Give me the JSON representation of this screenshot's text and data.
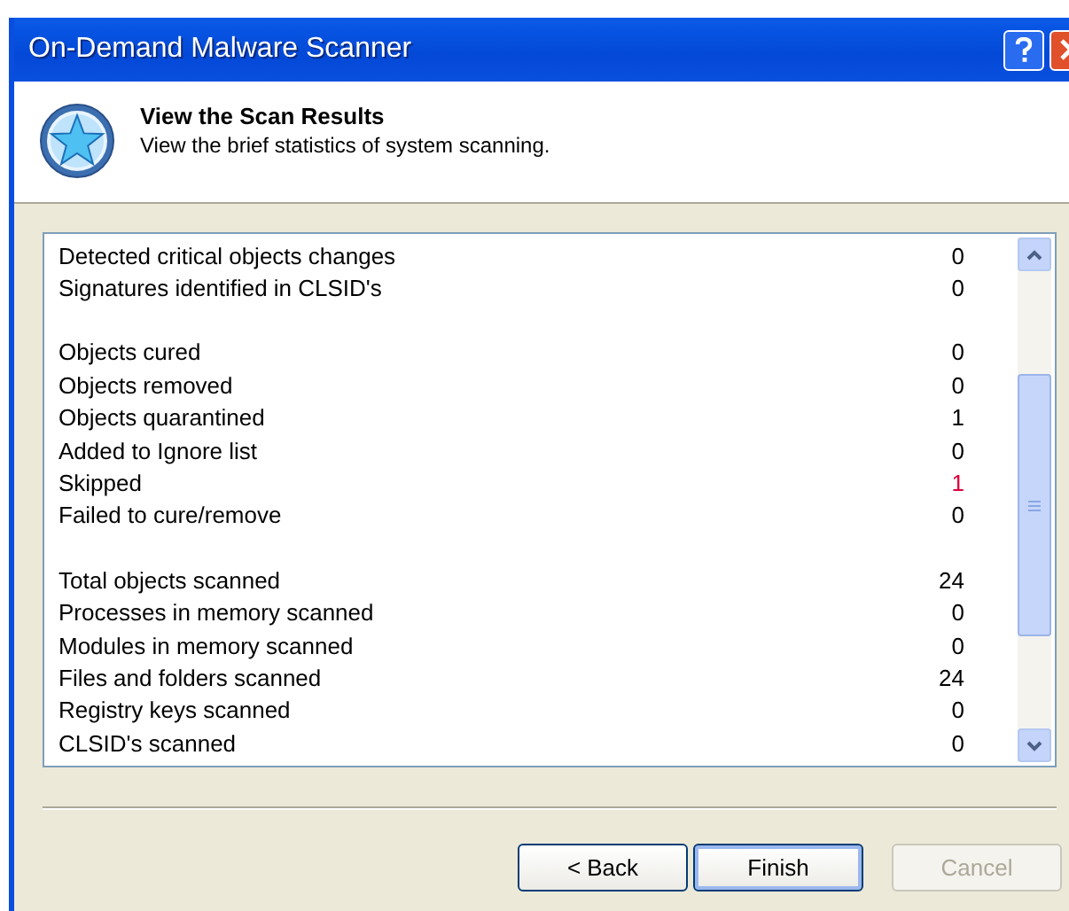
{
  "window": {
    "title": "On-Demand Malware Scanner"
  },
  "header": {
    "title": "View the Scan Results",
    "subtitle": "View the brief statistics of system scanning."
  },
  "results": {
    "groups": [
      {
        "rows": [
          {
            "label": "Detected critical objects changes",
            "value": "0",
            "color": "#000000"
          },
          {
            "label": "Signatures identified in CLSID's",
            "value": "0",
            "color": "#000000"
          }
        ]
      },
      {
        "rows": [
          {
            "label": "Objects cured",
            "value": "0",
            "color": "#000000"
          },
          {
            "label": "Objects removed",
            "value": "0",
            "color": "#000000"
          },
          {
            "label": "Objects quarantined",
            "value": "1",
            "color": "#000000"
          },
          {
            "label": "Added to Ignore list",
            "value": "0",
            "color": "#000000"
          },
          {
            "label": "Skipped",
            "value": "1",
            "color": "#e0003c"
          },
          {
            "label": "Failed to cure/remove",
            "value": "0",
            "color": "#000000"
          }
        ]
      },
      {
        "rows": [
          {
            "label": "Total objects scanned",
            "value": "24",
            "color": "#000000"
          },
          {
            "label": "Processes in memory scanned",
            "value": "0",
            "color": "#000000"
          },
          {
            "label": "Modules in memory scanned",
            "value": "0",
            "color": "#000000"
          },
          {
            "label": "Files and folders scanned",
            "value": "24",
            "color": "#000000"
          },
          {
            "label": "Registry keys scanned",
            "value": "0",
            "color": "#000000"
          },
          {
            "label": "CLSID's scanned",
            "value": "0",
            "color": "#000000"
          }
        ]
      }
    ]
  },
  "buttons": [
    {
      "label": "< Back",
      "disabled": false,
      "default": false
    },
    {
      "label": "Finish",
      "disabled": false,
      "default": true
    },
    {
      "label": "Cancel",
      "disabled": true,
      "default": false
    }
  ]
}
